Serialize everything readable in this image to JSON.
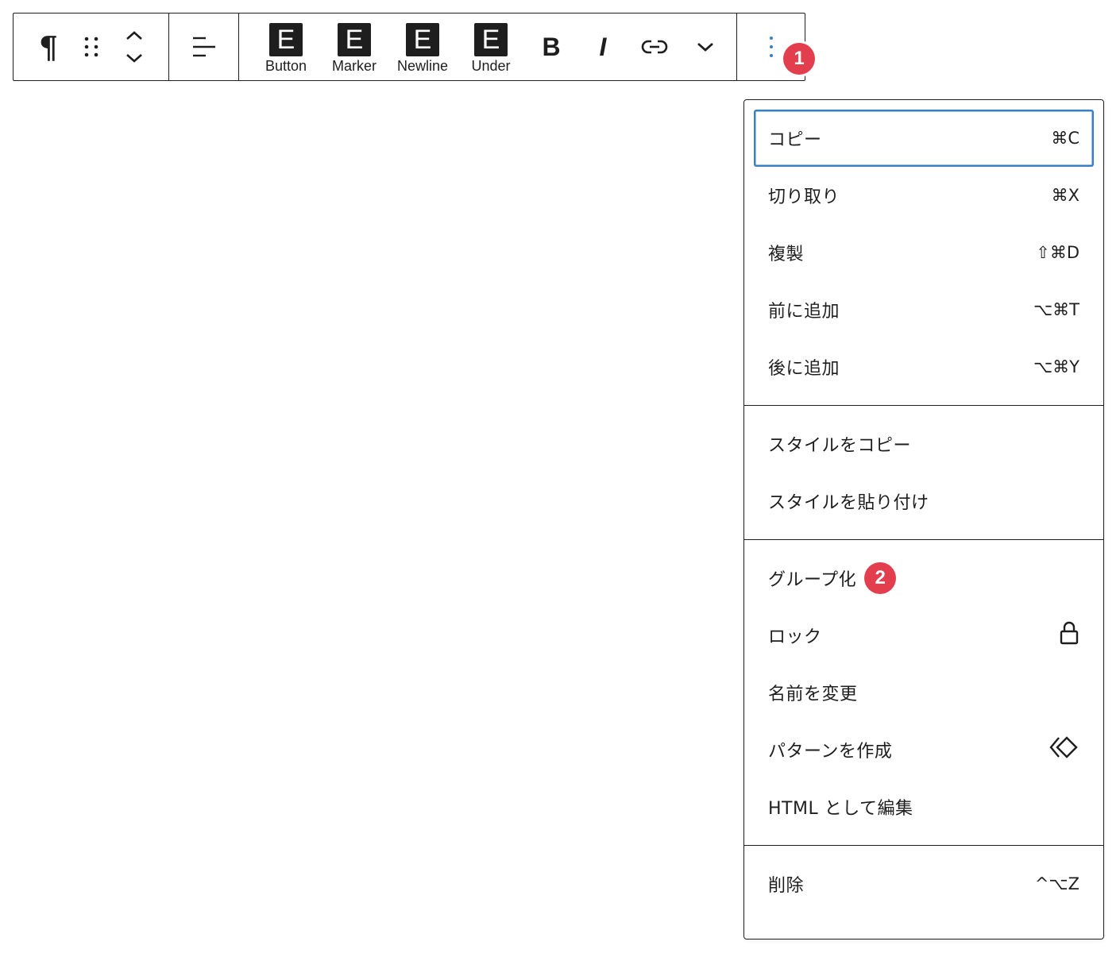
{
  "toolbar": {
    "block_type_icon": "pilcrow-icon",
    "drag_icon": "drag-handle-icon",
    "move_icon": "chevron-up-down-icon",
    "align_icon": "align-left-icon",
    "format_buttons": [
      {
        "glyph": "E",
        "label": "Button"
      },
      {
        "glyph": "E",
        "label": "Marker"
      },
      {
        "glyph": "E",
        "label": "Newline"
      },
      {
        "glyph": "E",
        "label": "Under"
      }
    ],
    "bold_glyph": "B",
    "italic_glyph": "I",
    "link_icon": "link-icon",
    "more_format_icon": "chevron-down-icon",
    "options_icon": "vertical-ellipsis-icon"
  },
  "annotations": {
    "badge_1": "1",
    "badge_2": "2",
    "badge_color": "#e23e4d"
  },
  "menu": {
    "sections": [
      {
        "items": [
          {
            "label": "コピー",
            "shortcut": "⌘C"
          },
          {
            "label": "切り取り",
            "shortcut": "⌘X"
          },
          {
            "label": "複製",
            "shortcut": "⇧⌘D"
          },
          {
            "label": "前に追加",
            "shortcut": "⌥⌘T"
          },
          {
            "label": "後に追加",
            "shortcut": "⌥⌘Y"
          }
        ]
      },
      {
        "items": [
          {
            "label": "スタイルをコピー"
          },
          {
            "label": "スタイルを貼り付け"
          }
        ]
      },
      {
        "items": [
          {
            "label": "グループ化"
          },
          {
            "label": "ロック",
            "icon": "lock-icon"
          },
          {
            "label": "名前を変更"
          },
          {
            "label": "パターンを作成",
            "icon": "symbol-diamond-icon"
          },
          {
            "label": "HTML として編集"
          }
        ]
      },
      {
        "items": [
          {
            "label": "削除",
            "shortcut": "^⌥Z"
          }
        ]
      }
    ],
    "focus_color": "#3a7fc4"
  }
}
